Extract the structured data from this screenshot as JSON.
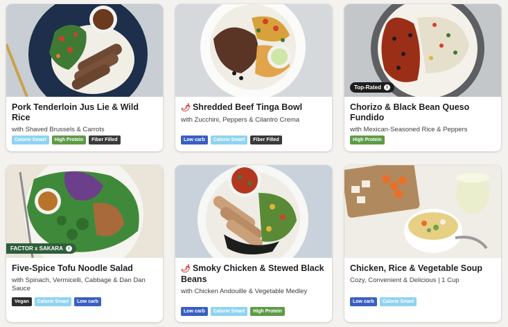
{
  "colors": {
    "calorie_smart": "#8fd3f1",
    "high_protein": "#5d9b47",
    "fiber_filled": "#3a3a3a",
    "low_carb": "#3a5fc0",
    "vegan": "#2f2f2f",
    "spicy": "#c8261c"
  },
  "meals": [
    {
      "title": "Pork Tenderloin Jus Lie & Wild Rice",
      "subtitle": "with Shaved Brussels & Carrots",
      "spicy": false,
      "overlay": "",
      "badges": [
        "Calorie Smart",
        "High Protein",
        "Fiber Filled"
      ]
    },
    {
      "title": "Shredded Beef Tinga Bowl",
      "subtitle": "with Zucchini, Peppers & Cilantro Crema",
      "spicy": true,
      "overlay": "",
      "badges": [
        "Low carb",
        "Calorie Smart",
        "Fiber Filled"
      ]
    },
    {
      "title": "Chorizo & Black Bean Queso Fundido",
      "subtitle": "with Mexican-Seasoned Rice & Peppers",
      "spicy": false,
      "overlay": "Top-Rated",
      "badges": [
        "High Protein"
      ]
    },
    {
      "title": "Five-Spice Tofu Noodle Salad",
      "subtitle": "with Spinach, Vermicelli, Cabbage & Dan Dan Sauce",
      "spicy": false,
      "overlay": "FACTOR x SAKARA",
      "badges": [
        "Vegan",
        "Calorie Smart",
        "Low carb"
      ]
    },
    {
      "title": "Smoky Chicken & Stewed Black Beans",
      "subtitle": "with Chicken Andouille & Vegetable Medley",
      "spicy": true,
      "overlay": "",
      "badges": [
        "Low carb",
        "Calorie Smart",
        "High Protein"
      ]
    },
    {
      "title": "Chicken, Rice & Vegetable Soup",
      "subtitle": "Cozy, Convenient & Delicious | 1 Cup",
      "spicy": false,
      "overlay": "",
      "badges": [
        "Low carb",
        "Calorie Smart"
      ]
    }
  ]
}
